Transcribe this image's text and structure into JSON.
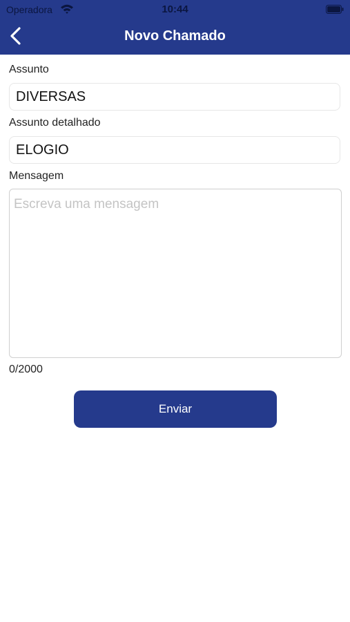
{
  "status_bar": {
    "carrier": "Operadora",
    "time": "10:44"
  },
  "nav": {
    "title": "Novo Chamado"
  },
  "form": {
    "assunto_label": "Assunto",
    "assunto_value": "DIVERSAS",
    "detalhado_label": "Assunto detalhado",
    "detalhado_value": "ELOGIO",
    "mensagem_label": "Mensagem",
    "mensagem_placeholder": "Escreva uma mensagem",
    "counter": "0/2000",
    "send_label": "Enviar"
  },
  "colors": {
    "primary": "#253a8c",
    "background": "#ffffff"
  }
}
